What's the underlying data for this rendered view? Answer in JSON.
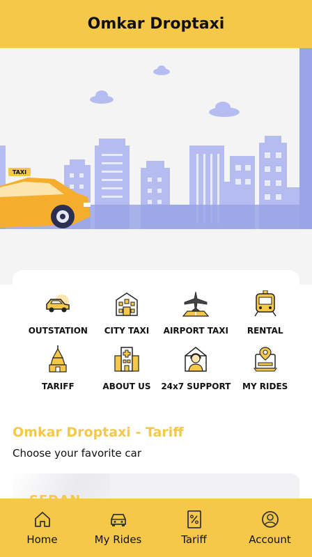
{
  "app": {
    "title": "Omkar Droptaxi"
  },
  "hero": {
    "taxi_sign": "TAXI"
  },
  "menu": [
    {
      "label": "OUTSTATION",
      "icon": "outstation-car-icon"
    },
    {
      "label": "CITY TAXI",
      "icon": "city-building-icon"
    },
    {
      "label": "AIRPORT TAXI",
      "icon": "airplane-icon"
    },
    {
      "label": "RENTAL",
      "icon": "train-icon"
    },
    {
      "label": "TARIFF",
      "icon": "temple-icon"
    },
    {
      "label": "ABOUT US",
      "icon": "hospital-building-icon"
    },
    {
      "label": "24x7 SUPPORT",
      "icon": "support-agent-icon"
    },
    {
      "label": "MY RIDES",
      "icon": "rides-location-icon"
    }
  ],
  "tariff": {
    "title": "Omkar Droptaxi - Tariff",
    "subtitle": "Choose your favorite car",
    "first_car_type": "SEDAN"
  },
  "bottom_nav": [
    {
      "label": "Home",
      "icon": "home-icon"
    },
    {
      "label": "My Rides",
      "icon": "car-icon"
    },
    {
      "label": "Tariff",
      "icon": "percent-tag-icon"
    },
    {
      "label": "Account",
      "icon": "account-icon"
    }
  ],
  "colors": {
    "accent": "#f5c84a",
    "skyline": "#b5bdf0",
    "skyline_dark": "#9aa4e6"
  }
}
